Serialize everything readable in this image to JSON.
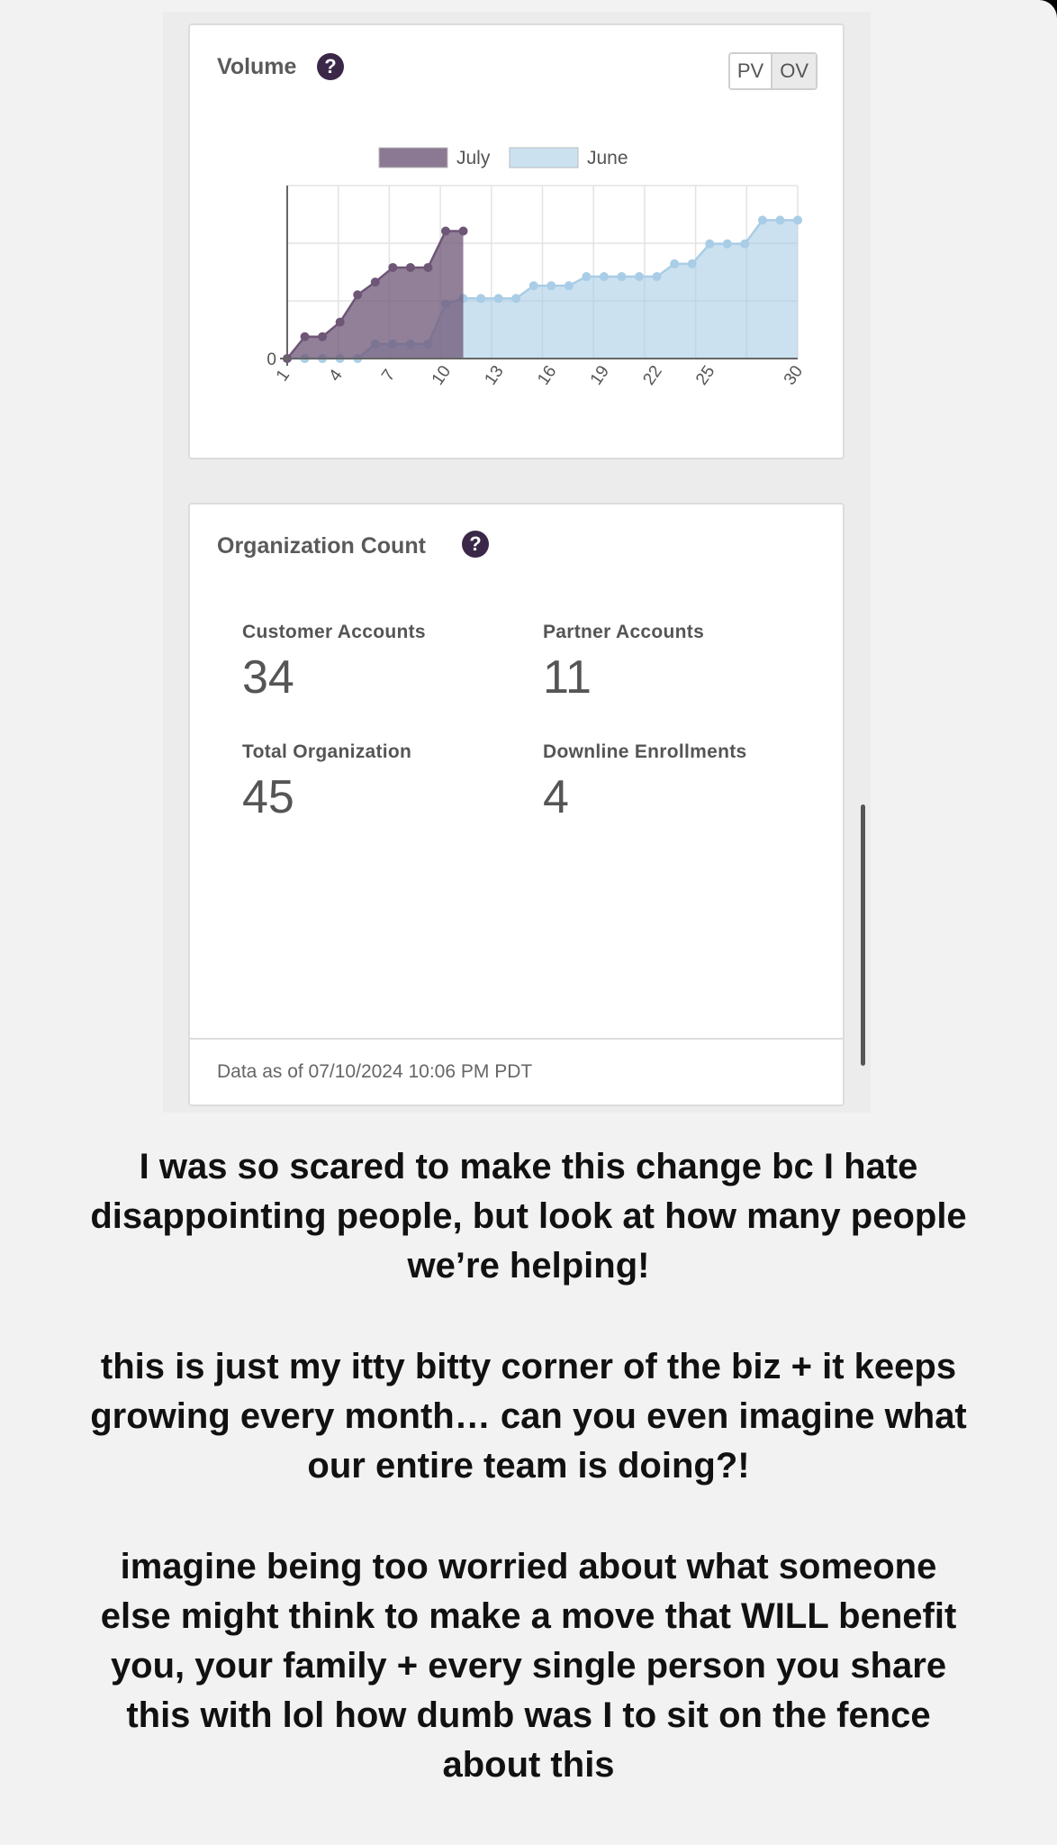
{
  "volume": {
    "title": "Volume",
    "help_icon": "?",
    "toggle": {
      "pv": "PV",
      "ov": "OV"
    }
  },
  "chart_data": {
    "type": "area",
    "title": "Volume",
    "legend": [
      "July",
      "June"
    ],
    "legend_position": "top-center",
    "x_ticks": [
      "1",
      "4",
      "7",
      "10",
      "13",
      "16",
      "19",
      "22",
      "25",
      "30"
    ],
    "y_ticks": [
      "0"
    ],
    "grid": true,
    "colors": {
      "July": "#6e5677",
      "June": "#a9cde6"
    },
    "series": [
      {
        "name": "July",
        "x": [
          1,
          2,
          3,
          4,
          5,
          6,
          7,
          8,
          9,
          10,
          11
        ],
        "y": [
          0,
          12,
          12,
          20,
          35,
          42,
          50,
          50,
          50,
          70,
          70
        ]
      },
      {
        "name": "June",
        "x": [
          1,
          2,
          3,
          4,
          5,
          6,
          7,
          8,
          9,
          10,
          11,
          12,
          13,
          14,
          15,
          16,
          17,
          18,
          19,
          20,
          21,
          22,
          23,
          24,
          25,
          26,
          27,
          28,
          29,
          30
        ],
        "y": [
          0,
          0,
          0,
          0,
          0,
          8,
          8,
          8,
          8,
          30,
          33,
          33,
          33,
          33,
          40,
          40,
          40,
          45,
          45,
          45,
          45,
          45,
          52,
          52,
          63,
          63,
          63,
          76,
          76,
          76
        ]
      }
    ]
  },
  "org": {
    "title": "Organization Count",
    "help_icon": "?",
    "stats": [
      {
        "label": "Customer Accounts",
        "value": "34"
      },
      {
        "label": "Partner Accounts",
        "value": "11"
      },
      {
        "label": "Total Organization",
        "value": "45"
      },
      {
        "label": "Downline Enrollments",
        "value": "4"
      }
    ],
    "footer": "Data as of 07/10/2024 10:06 PM PDT"
  },
  "caption": {
    "p1": "I was so scared to make this change bc I hate disappointing people, but look at how many people we’re helping!",
    "p2": "this is just my itty bitty corner of the biz + it keeps growing every month… can you even imagine what our entire team is doing?!",
    "p3": "imagine being too worried about what someone else might think to make a move that WILL benefit you, your family + every single person you share this with lol how dumb was I to sit on the fence about this"
  }
}
